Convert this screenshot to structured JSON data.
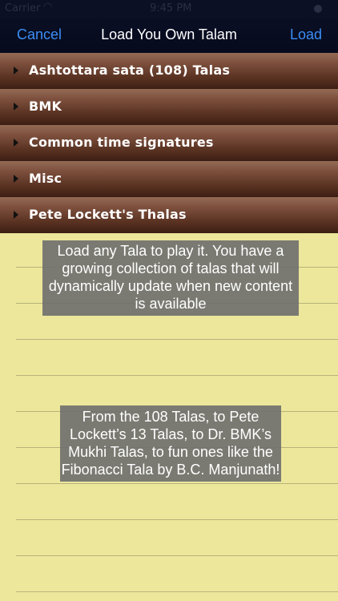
{
  "status_bar": {
    "carrier": "Carrier",
    "time": "9:45 PM"
  },
  "nav": {
    "cancel_label": "Cancel",
    "title": "Load You Own Talam",
    "load_label": "Load"
  },
  "list": {
    "items": [
      {
        "label": "Ashtottara sata (108) Talas"
      },
      {
        "label": "BMK"
      },
      {
        "label": "Common time signatures"
      },
      {
        "label": "Misc"
      },
      {
        "label": "Pete Lockett's Thalas"
      }
    ]
  },
  "callouts": {
    "first": "Load any Tala to play it. You have a growing collection of talas that will dynamically update when new content is available",
    "second": "From the 108 Talas, to Pete Lockett’s 13 Talas, to Dr. BMK’s Mukhi Talas, to fun ones like the Fibonacci Tala by B.C. Manjunath!"
  },
  "colors": {
    "accent": "#3b8ef5",
    "paper": "#ece79b",
    "row_wood": "#7c4f3d",
    "navbar": "#0a0f24"
  }
}
